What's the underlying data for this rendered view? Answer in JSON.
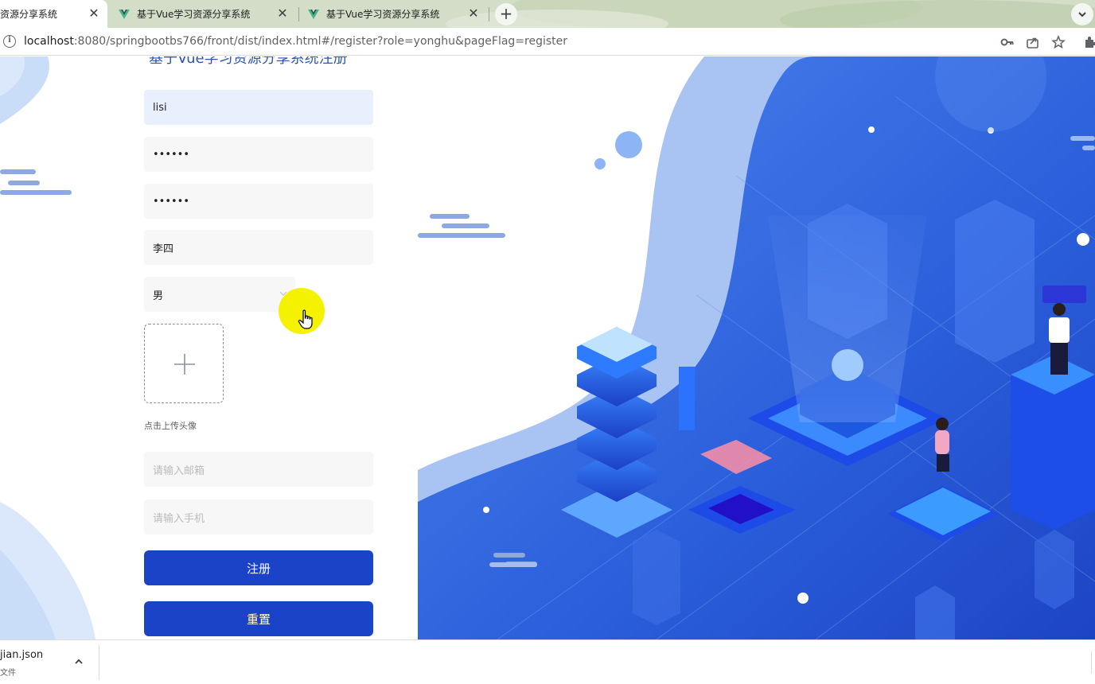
{
  "browser": {
    "tabs": [
      {
        "title": "资源分享系统",
        "active": true
      },
      {
        "title": "基于Vue学习资源分享系统",
        "active": false
      },
      {
        "title": "基于Vue学习资源分享系统",
        "active": false
      }
    ],
    "close_glyph": "✕",
    "new_tab_glyph": "+",
    "url_host": "localhost",
    "url_rest": ":8080/springbootbs766/front/dist/index.html#/register?role=yonghu&pageFlag=register"
  },
  "form": {
    "title": "基于Vue学习资源分享系统注册",
    "account_value": "lisi",
    "password_value": "••••••",
    "confirm_password_value": "••••••",
    "name_value": "李四",
    "gender_value": "男",
    "upload_hint": "点击上传头像",
    "email_placeholder": "请输入邮箱",
    "phone_placeholder": "请输入手机",
    "register_button": "注册",
    "reset_button": "重置"
  },
  "downloads": {
    "file_name": "jian.json",
    "file_sub": "文件"
  },
  "colors": {
    "primary_button": "#1b43c8",
    "title_blue": "#2f54b9",
    "cursor_highlight": "#f5f200"
  }
}
